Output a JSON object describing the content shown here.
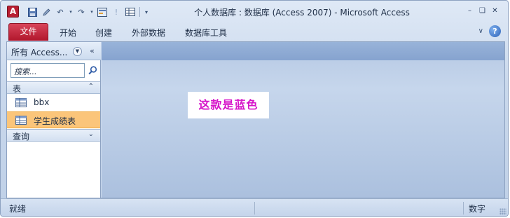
{
  "window": {
    "title": "个人数据库 : 数据库 (Access 2007)  -  Microsoft Access",
    "app_icon_letter": "A"
  },
  "ribbon": {
    "file_tab": "文件",
    "tabs": [
      "开始",
      "创建",
      "外部数据",
      "数据库工具"
    ]
  },
  "nav_pane": {
    "title": "所有 Access...",
    "search_placeholder": "搜索...",
    "groups": [
      {
        "label": "表",
        "state": "expanded",
        "items": [
          "bbx",
          "学生成绩表"
        ],
        "selected_item": "学生成绩表"
      },
      {
        "label": "查询",
        "state": "collapsed",
        "items": []
      }
    ]
  },
  "workspace": {
    "note_text": "这款是蓝色"
  },
  "statusbar": {
    "left": "就绪",
    "right": "数字"
  },
  "colors": {
    "file_tab": "#b81f33",
    "note_text": "#d614c9",
    "selected_item": "#fbc57a"
  }
}
